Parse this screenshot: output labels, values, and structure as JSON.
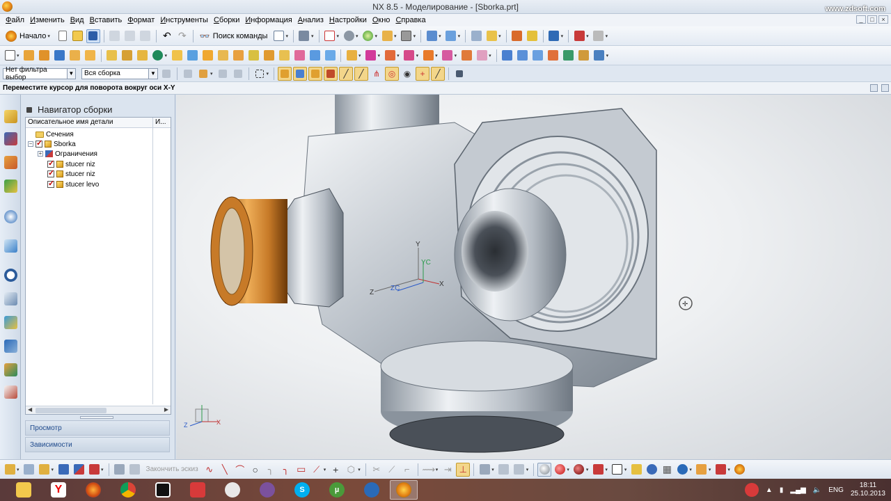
{
  "window": {
    "title": "NX 8.5 - Моделирование - [Sborka.prt]",
    "watermark": "www.zdsoft.com"
  },
  "menu": [
    "Файл",
    "Изменить",
    "Вид",
    "Вставить",
    "Формат",
    "Инструменты",
    "Сборки",
    "Информация",
    "Анализ",
    "Настройки",
    "Окно",
    "Справка"
  ],
  "toolbar": {
    "start_label": "Начало",
    "search_label": "Поиск команды"
  },
  "selection": {
    "filter_value": "Нет фильтра выбор",
    "scope_value": "Вся сборка"
  },
  "prompt": {
    "text": "Переместите курсор для поворота вокруг оси X-Y"
  },
  "navigator": {
    "title": "Навигатор сборки",
    "col_name": "Описательное имя детали",
    "col_info": "И...",
    "items": [
      {
        "label": "Сечения"
      },
      {
        "label": "Sborka"
      },
      {
        "label": "Ограничения"
      },
      {
        "label": "stucer niz"
      },
      {
        "label": "stucer niz"
      },
      {
        "label": "stucer levo"
      }
    ],
    "panel_preview": "Просмотр",
    "panel_deps": "Зависимости"
  },
  "bottom_toolbar": {
    "finish_sketch": "Закончить эскиз"
  },
  "taskbar": {
    "lang": "ENG",
    "time": "18:11",
    "date": "25.10.2013"
  },
  "triad": {
    "x": "X",
    "y": "Y",
    "z": "Z",
    "xc": "X",
    "yc": "YC",
    "zc": "ZC"
  }
}
